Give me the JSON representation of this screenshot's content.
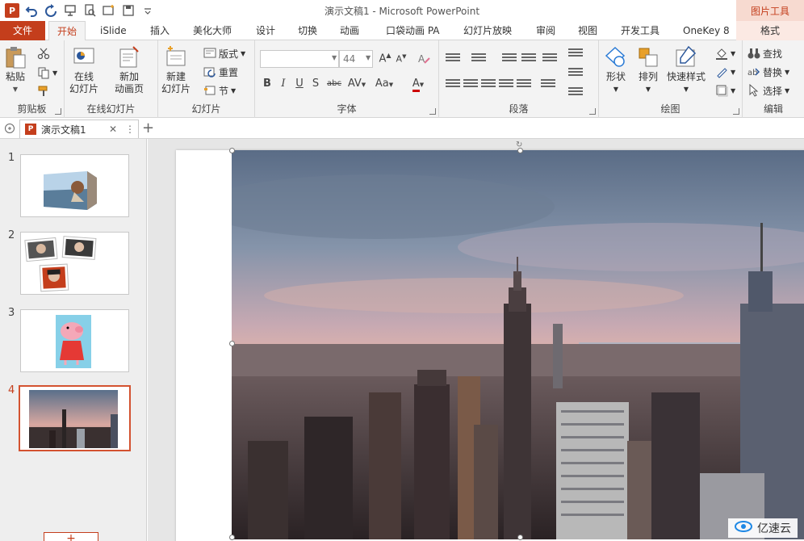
{
  "titlebar": {
    "title": "演示文稿1 - Microsoft PowerPoint",
    "contextual_group": "图片工具",
    "app_logo": "P"
  },
  "tabs": [
    {
      "id": "file",
      "label": "文件"
    },
    {
      "id": "home",
      "label": "开始"
    },
    {
      "id": "islide",
      "label": "iSlide"
    },
    {
      "id": "insert",
      "label": "插入"
    },
    {
      "id": "meihua",
      "label": "美化大师"
    },
    {
      "id": "design",
      "label": "设计"
    },
    {
      "id": "transitions",
      "label": "切换"
    },
    {
      "id": "animations",
      "label": "动画"
    },
    {
      "id": "pocket",
      "label": "口袋动画 PA"
    },
    {
      "id": "slideshow",
      "label": "幻灯片放映"
    },
    {
      "id": "review",
      "label": "审阅"
    },
    {
      "id": "view",
      "label": "视图"
    },
    {
      "id": "developer",
      "label": "开发工具"
    },
    {
      "id": "onekey",
      "label": "OneKey 8"
    },
    {
      "id": "format",
      "label": "格式"
    }
  ],
  "ribbon": {
    "clipboard": {
      "label": "剪贴板",
      "paste": "粘贴"
    },
    "online": {
      "label": "在线幻灯片",
      "online_slides": [
        "在线",
        "幻灯片"
      ],
      "new_anim": [
        "新加",
        "动画页"
      ]
    },
    "slides": {
      "label": "幻灯片",
      "new_slide": [
        "新建",
        "幻灯片"
      ],
      "layout": "版式",
      "reset": "重置",
      "section": "节"
    },
    "font": {
      "label": "字体",
      "font_name": "",
      "font_size": "44"
    },
    "paragraph": {
      "label": "段落"
    },
    "drawing": {
      "label": "绘图",
      "shapes": "形状",
      "arrange": "排列",
      "quick_styles": "快速样式"
    },
    "editing": {
      "label": "编辑",
      "find": "查找",
      "replace": "替换",
      "select": "选择"
    }
  },
  "doc_tab": {
    "name": "演示文稿1"
  },
  "slides": [
    {
      "num": "1"
    },
    {
      "num": "2"
    },
    {
      "num": "3"
    },
    {
      "num": "4"
    }
  ],
  "add_slide": "+",
  "watermark": "亿速云",
  "colors": {
    "accent": "#c43e1c",
    "ribbon_bg": "#f3f3f3"
  }
}
